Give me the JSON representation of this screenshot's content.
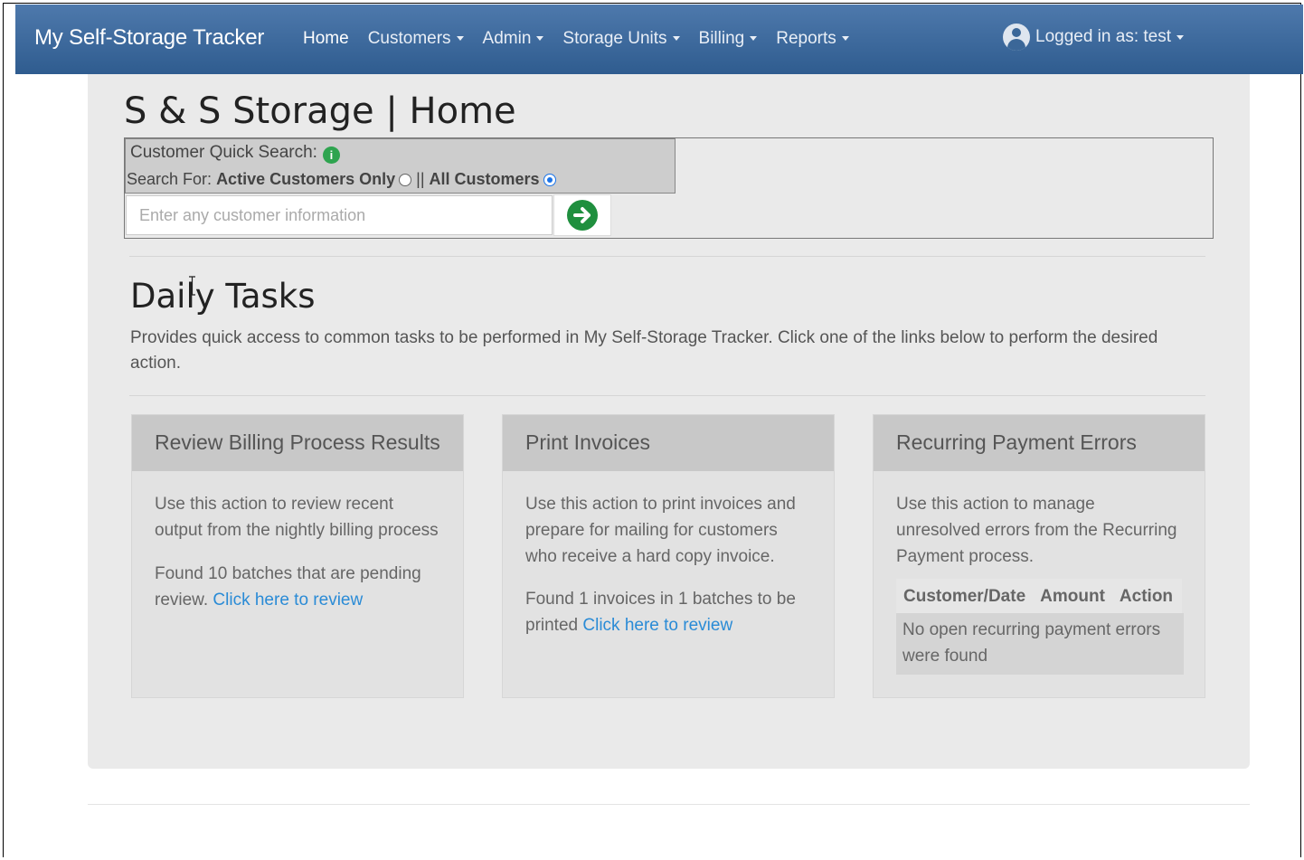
{
  "navbar": {
    "brand": "My Self-Storage Tracker",
    "items": [
      {
        "label": "Home",
        "dropdown": false,
        "active": true
      },
      {
        "label": "Customers",
        "dropdown": true
      },
      {
        "label": "Admin",
        "dropdown": true
      },
      {
        "label": "Storage Units",
        "dropdown": true
      },
      {
        "label": "Billing",
        "dropdown": true
      },
      {
        "label": "Reports",
        "dropdown": true
      }
    ],
    "user_label": "Logged in as: test",
    "bg_color": "#3d6a9d"
  },
  "page": {
    "title": "S & S Storage | Home"
  },
  "quick_search": {
    "label": "Customer Quick Search:",
    "search_for_prefix": "Search For:",
    "option_active": "Active Customers Only",
    "separator": "||",
    "option_all": "All Customers",
    "selected": "All Customers",
    "placeholder": "Enter any customer information",
    "value": ""
  },
  "daily_tasks": {
    "title": "Daily Tasks",
    "description": "Provides quick access to common tasks to be performed in My Self-Storage Tracker. Click one of the links below to perform the desired action."
  },
  "cards": {
    "billing": {
      "title": "Review Billing Process Results",
      "body": "Use this action to review recent output from the nightly billing process",
      "status": "Found 10 batches that are pending review.",
      "link": "Click here to review"
    },
    "invoices": {
      "title": "Print Invoices",
      "body": "Use this action to print invoices and prepare for mailing for customers who receive a hard copy invoice.",
      "status": "Found 1 invoices in 1 batches to be printed",
      "link": "Click here to review"
    },
    "recurring": {
      "title": "Recurring Payment Errors",
      "body": "Use this action to manage unresolved errors from the Recurring Payment process.",
      "columns": [
        "Customer/Date",
        "Amount",
        "Action"
      ],
      "empty": "No open recurring payment errors were found"
    }
  },
  "colors": {
    "link": "#2a8bd6",
    "go_button": "#1f8f3e",
    "info_icon": "#2ea44f",
    "radio_selected": "#1a73e8"
  }
}
